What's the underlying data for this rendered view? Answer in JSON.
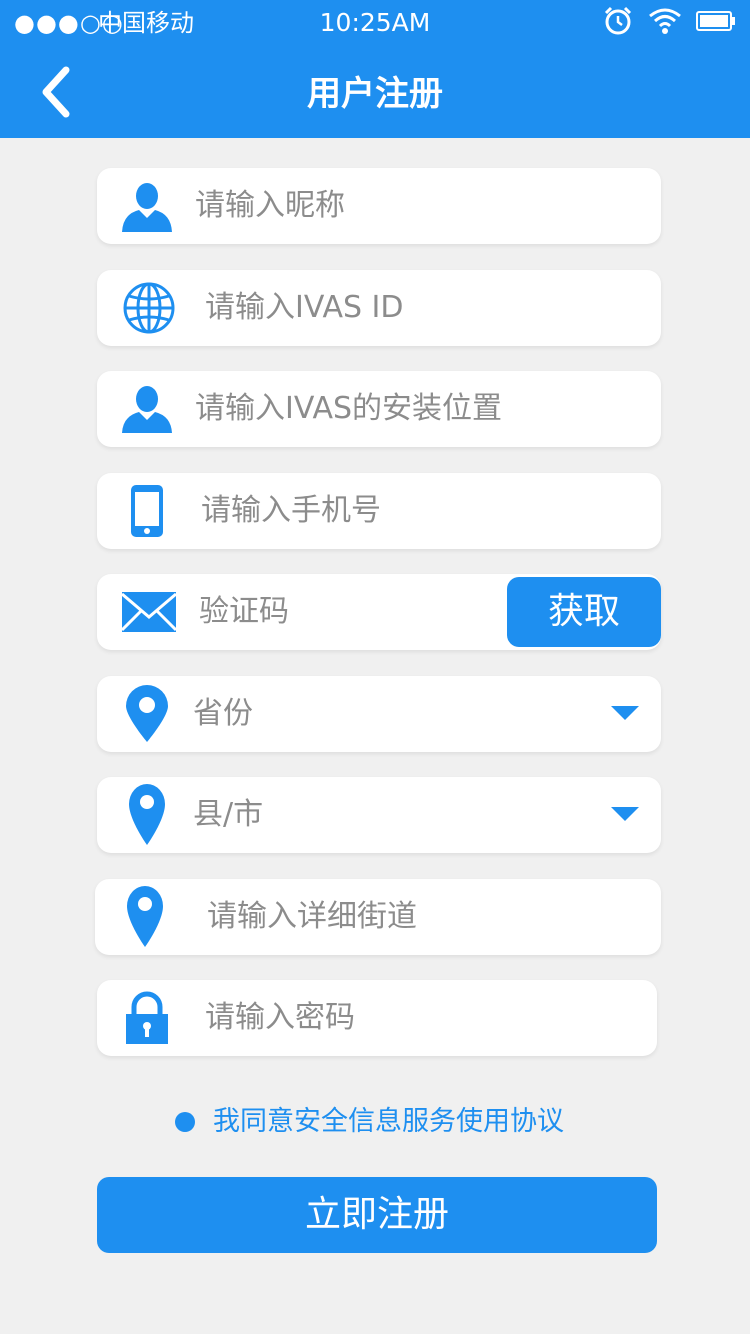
{
  "status_bar": {
    "signal": "●●●○○",
    "carrier": "中国移动",
    "time": "10:25AM",
    "icons": [
      "alarm-icon",
      "wifi-icon",
      "battery-icon"
    ]
  },
  "nav": {
    "title": "用户注册",
    "back_icon": "chevron-left-icon"
  },
  "form": {
    "nickname": {
      "placeholder": "请输入昵称",
      "icon": "user-icon"
    },
    "ivas_id": {
      "placeholder": "请输入IVAS  ID",
      "icon": "globe-icon"
    },
    "install_location": {
      "placeholder": "请输入IVAS的安装位置",
      "icon": "user-icon"
    },
    "phone": {
      "placeholder": "请输入手机号",
      "icon": "phone-icon"
    },
    "code": {
      "placeholder": "验证码",
      "icon": "mail-icon",
      "button": "获取"
    },
    "province": {
      "placeholder": "省份",
      "icon": "location-pin-icon"
    },
    "city": {
      "placeholder": "县/市",
      "icon": "location-pin-icon"
    },
    "street": {
      "placeholder": "请输入详细街道",
      "icon": "location-pin-icon"
    },
    "password": {
      "placeholder": "请输入密码",
      "icon": "lock-icon"
    }
  },
  "agreement": {
    "text": "我同意安全信息服务使用协议"
  },
  "submit": {
    "label": "立即注册"
  },
  "colors": {
    "primary": "#1e8ff0",
    "background": "#f0f0f0",
    "placeholder": "#8c8c8c"
  }
}
